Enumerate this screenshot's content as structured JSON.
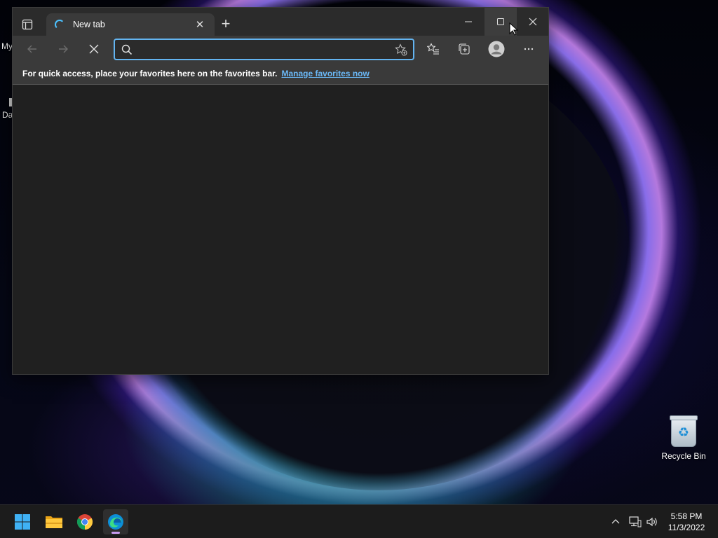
{
  "desktop": {
    "partial_icons": [
      "My",
      "Da"
    ],
    "recycle_bin_label": "Recycle Bin"
  },
  "browser": {
    "tab": {
      "title": "New tab"
    },
    "address_bar": {
      "value": "",
      "placeholder": ""
    },
    "favorites_bar": {
      "message": "For quick access, place your favorites here on the favorites bar.",
      "link": "Manage favorites now"
    }
  },
  "taskbar": {
    "apps": [
      "start-icon",
      "file-explorer-icon",
      "chrome-icon",
      "edge-icon"
    ],
    "clock": {
      "time": "5:58 PM",
      "date": "11/3/2022"
    }
  },
  "colors": {
    "accent": "#63b4f0",
    "link": "#6ab7f5",
    "window_bg": "#202020",
    "toolbar_bg": "#3a3a3a"
  }
}
